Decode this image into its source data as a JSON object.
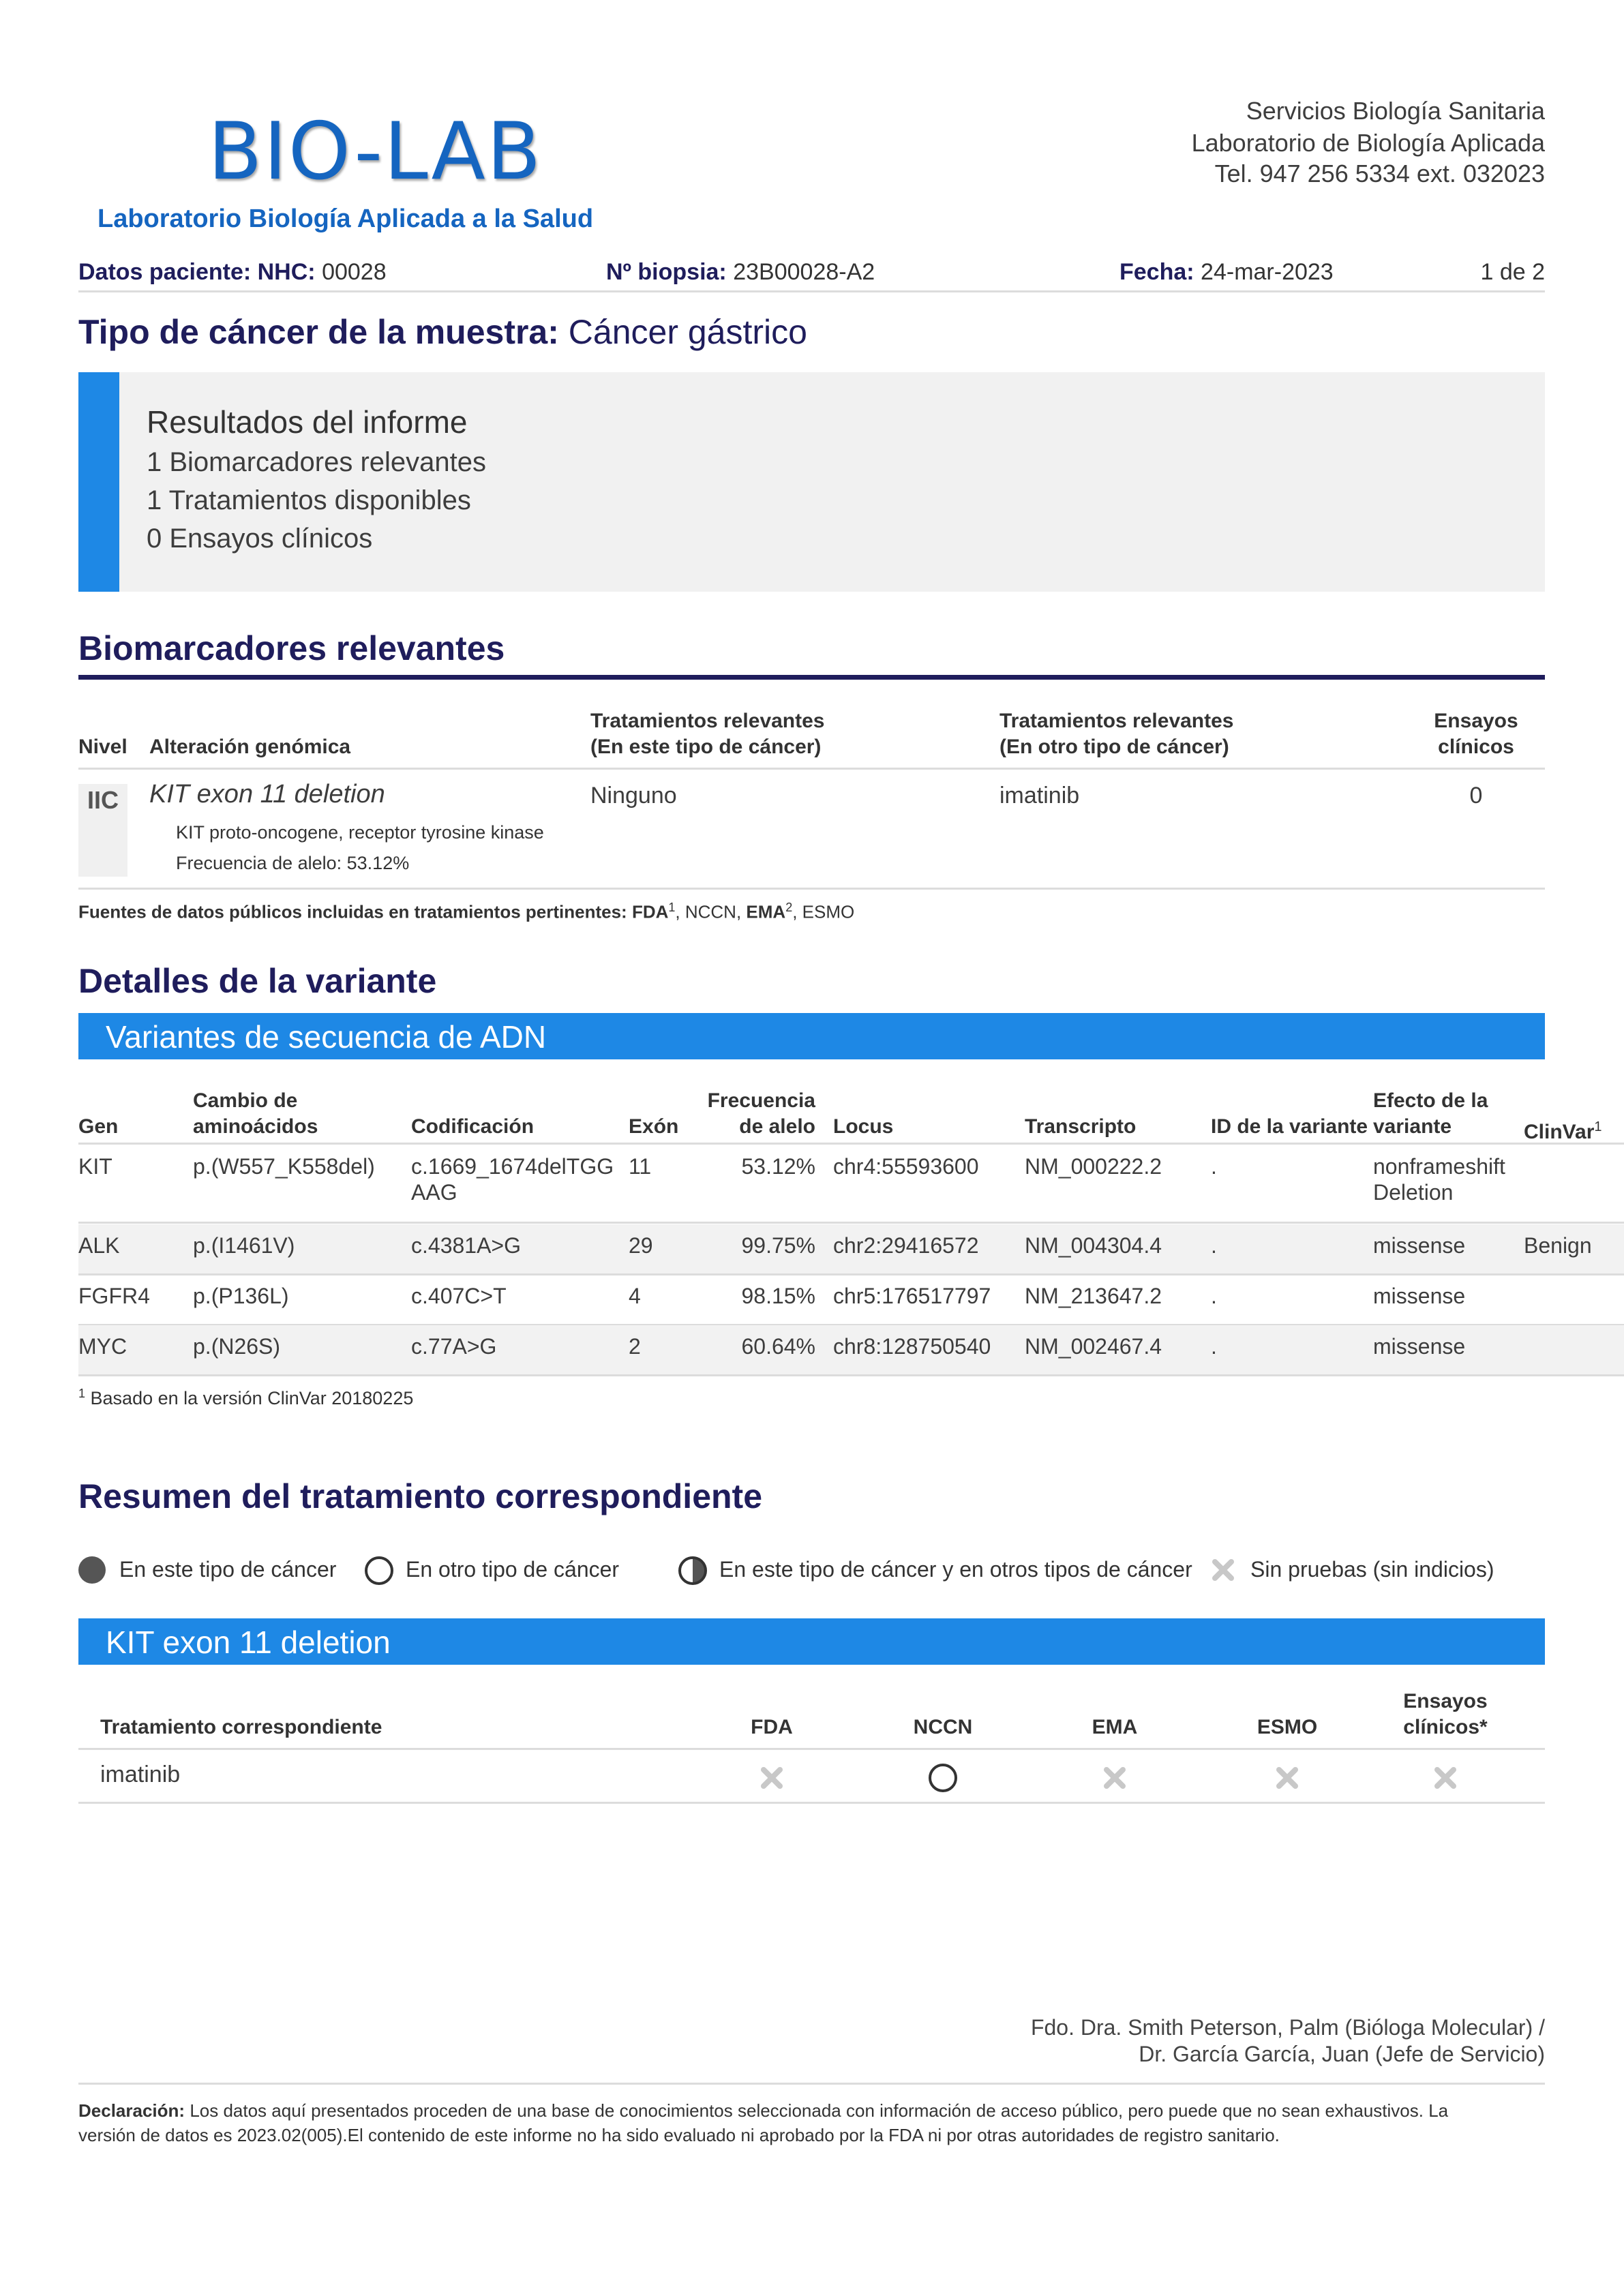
{
  "header": {
    "logo_main": "BIO-LAB",
    "logo_sub": "Laboratorio Biología Aplicada a la Salud",
    "org_line1": "Servicios Biología Sanitaria",
    "org_line2": "Laboratorio de Biología Aplicada",
    "org_line3": "Tel. 947 256 5334 ext. 032023"
  },
  "patient_bar": {
    "nhc_label": "Datos paciente: NHC:",
    "nhc_value": "00028",
    "biopsy_label": "Nº biopsia:",
    "biopsy_value": "23B00028-A2",
    "date_label": "Fecha:",
    "date_value": "24-mar-2023",
    "page": "1 de 2"
  },
  "cancer_type": {
    "label": "Tipo de cáncer de la muestra:",
    "value": "Cáncer gástrico"
  },
  "results": {
    "title": "Resultados del informe",
    "lines": [
      "1 Biomarcadores relevantes",
      "1 Tratamientos disponibles",
      "0 Ensayos clínicos"
    ]
  },
  "biomarkers": {
    "title": "Biomarcadores relevantes",
    "headers": {
      "level": "Nivel",
      "alteration": "Alteración genómica",
      "treat_this_1": "Tratamientos relevantes",
      "treat_this_2": "(En este tipo de cáncer)",
      "treat_other_1": "Tratamientos relevantes",
      "treat_other_2": "(En otro tipo de cáncer)",
      "trials_1": "Ensayos",
      "trials_2": "clínicos"
    },
    "row": {
      "level": "IIC",
      "alteration": "KIT exon 11 deletion",
      "gene_desc": "KIT proto-oncogene, receptor tyrosine kinase",
      "allele_freq": "Frecuencia de alelo: 53.12%",
      "treat_this": "Ninguno",
      "treat_other": "imatinib",
      "trials": "0"
    },
    "sources_label": "Fuentes de datos públicos incluidas en tratamientos pertinentes:",
    "src_fda": "FDA",
    "src_fda_sup": "1",
    "src_nccn": ", NCCN, ",
    "src_ema": "EMA",
    "src_ema_sup": "2",
    "src_esmo": ", ESMO"
  },
  "variant_details": {
    "title": "Detalles de la variante",
    "band": "Variantes de secuencia de ADN",
    "headers": {
      "gene": "Gen",
      "aa_1": "Cambio de",
      "aa_2": "aminoácidos",
      "coding": "Codificación",
      "exon": "Exón",
      "freq_1": "Frecuencia",
      "freq_2": "de alelo",
      "locus": "Locus",
      "transcript": "Transcripto",
      "variant_id": "ID de la variante",
      "effect_1": "Efecto de la",
      "effect_2": "variante",
      "clinvar": "ClinVar",
      "clinvar_sup": "1"
    },
    "rows": [
      {
        "gene": "KIT",
        "aa": "p.(W557_K558del)",
        "coding_1": "c.1669_1674delTGG",
        "coding_2": "AAG",
        "exon": "11",
        "freq": "53.12%",
        "locus": "chr4:55593600",
        "transcript": "NM_000222.2",
        "id": ".",
        "effect_1": "nonframeshift",
        "effect_2": "Deletion",
        "clinvar": ""
      },
      {
        "gene": "ALK",
        "aa": "p.(I1461V)",
        "coding_1": "c.4381A>G",
        "coding_2": "",
        "exon": "29",
        "freq": "99.75%",
        "locus": "chr2:29416572",
        "transcript": "NM_004304.4",
        "id": ".",
        "effect_1": "missense",
        "effect_2": "",
        "clinvar": "Benign"
      },
      {
        "gene": "FGFR4",
        "aa": "p.(P136L)",
        "coding_1": "c.407C>T",
        "coding_2": "",
        "exon": "4",
        "freq": "98.15%",
        "locus": "chr5:176517797",
        "transcript": "NM_213647.2",
        "id": ".",
        "effect_1": "missense",
        "effect_2": "",
        "clinvar": ""
      },
      {
        "gene": "MYC",
        "aa": "p.(N26S)",
        "coding_1": "c.77A>G",
        "coding_2": "",
        "exon": "2",
        "freq": "60.64%",
        "locus": "chr8:128750540",
        "transcript": "NM_002467.4",
        "id": ".",
        "effect_1": "missense",
        "effect_2": "",
        "clinvar": ""
      }
    ],
    "footnote_sup": "1",
    "footnote": "Basado en la versión ClinVar 20180225"
  },
  "treatment_summary": {
    "title": "Resumen del tratamiento correspondiente",
    "legend": {
      "this": "En este tipo de cáncer",
      "other": "En otro tipo de cáncer",
      "both": "En este tipo de cáncer y en otros tipos de cáncer",
      "none": "Sin pruebas (sin indicios)"
    },
    "band": "KIT exon 11 deletion",
    "headers": {
      "treatment": "Tratamiento correspondiente",
      "fda": "FDA",
      "nccn": "NCCN",
      "ema": "EMA",
      "esmo": "ESMO",
      "trials_1": "Ensayos",
      "trials_2": "clínicos*"
    },
    "row": {
      "treatment": "imatinib",
      "fda": "cross-icon",
      "nccn": "open-circle-icon",
      "ema": "cross-icon",
      "esmo": "cross-icon",
      "trials": "cross-icon"
    }
  },
  "signature": {
    "line1": "Fdo. Dra. Smith Peterson, Palm (Bióloga Molecular) /",
    "line2": "Dr. García García, Juan (Jefe de Servicio)"
  },
  "disclaimer": {
    "label": "Declaración:",
    "text": "Los datos aquí presentados proceden de una base de conocimientos seleccionada con información de acceso público, pero puede que no sean exhaustivos. La",
    "text2": "versión de datos es 2023.02(005).El contenido de este informe no ha sido evaluado ni aprobado por la FDA ni por otras autoridades de registro sanitario."
  },
  "colors": {
    "accent_blue": "#1e88e5",
    "logo_blue": "#1565c0",
    "heading_navy": "#1f1d5c",
    "panel_gray": "#f1f1f1"
  }
}
